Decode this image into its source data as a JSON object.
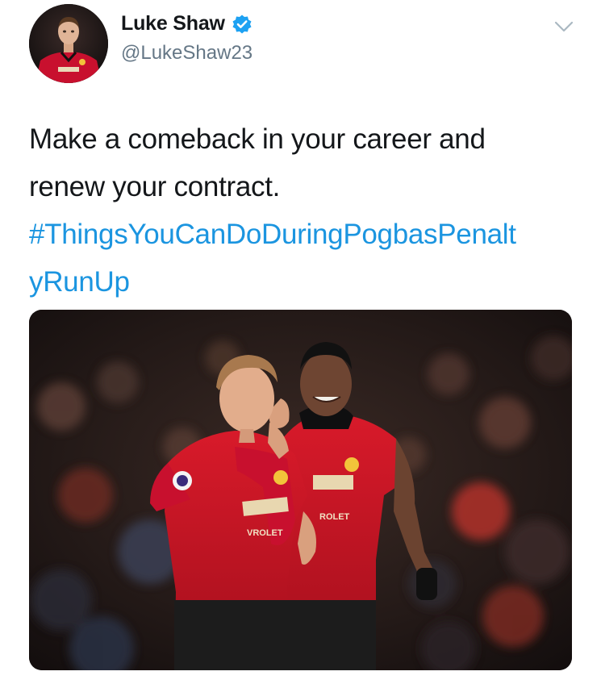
{
  "tweet": {
    "author": {
      "display_name": "Luke Shaw",
      "handle": "@LukeShaw23",
      "verified": true,
      "avatar_icon": "profile-photo"
    },
    "text_lines": [
      "Make a comeback in your career and",
      "renew your contract."
    ],
    "hashtag_lines": [
      "#ThingsYouCanDoDuringPogbasPenalt",
      "yRunUp"
    ],
    "media": {
      "kit_sponsor_text_1": "ROLET",
      "kit_sponsor_text_2": "VROLET"
    },
    "colors": {
      "hashtag": "#1b95e0",
      "verified_badge": "#1da1f2",
      "kit_red": "#c8102e"
    },
    "menu_icon": "chevron-down-icon"
  }
}
